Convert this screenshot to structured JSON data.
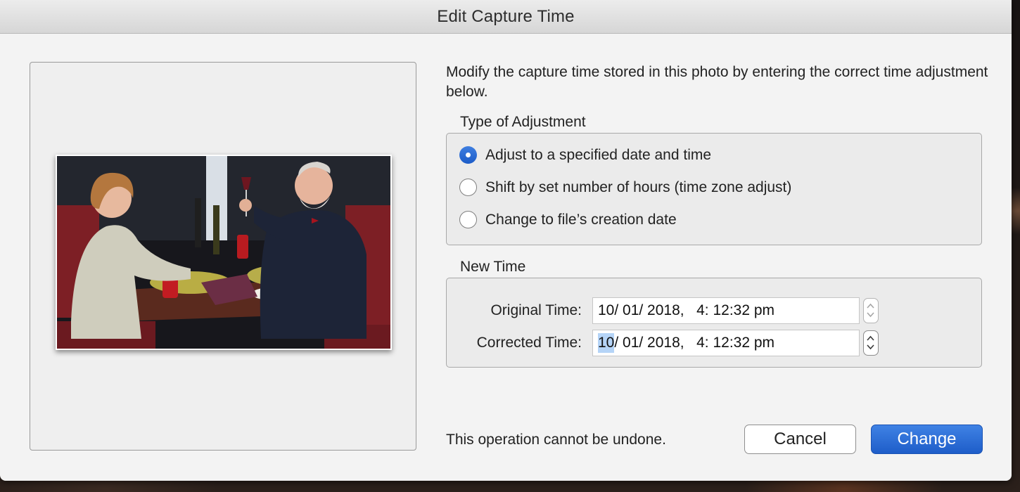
{
  "dialog": {
    "title": "Edit Capture Time",
    "intro_text": "Modify the capture time stored in this photo by entering the correct time adjustment below.",
    "adjustment": {
      "label": "Type of Adjustment",
      "options": [
        {
          "label": "Adjust to a specified date and time",
          "selected": true
        },
        {
          "label": "Shift by set number of hours (time zone adjust)",
          "selected": false
        },
        {
          "label": "Change to file’s creation date",
          "selected": false
        }
      ]
    },
    "new_time": {
      "label": "New Time",
      "original_label": "Original Time:",
      "original_value": "10/ 01/ 2018,   4: 12:32 pm",
      "corrected_label": "Corrected Time:",
      "corrected_selected_segment": "10",
      "corrected_rest": "/ 01/ 2018,   4: 12:32 pm"
    },
    "warning": "This operation cannot be undone.",
    "buttons": {
      "cancel": "Cancel",
      "change": "Change"
    },
    "colors": {
      "accent": "#2a6cd6",
      "selection": "#b5d4f7"
    }
  }
}
